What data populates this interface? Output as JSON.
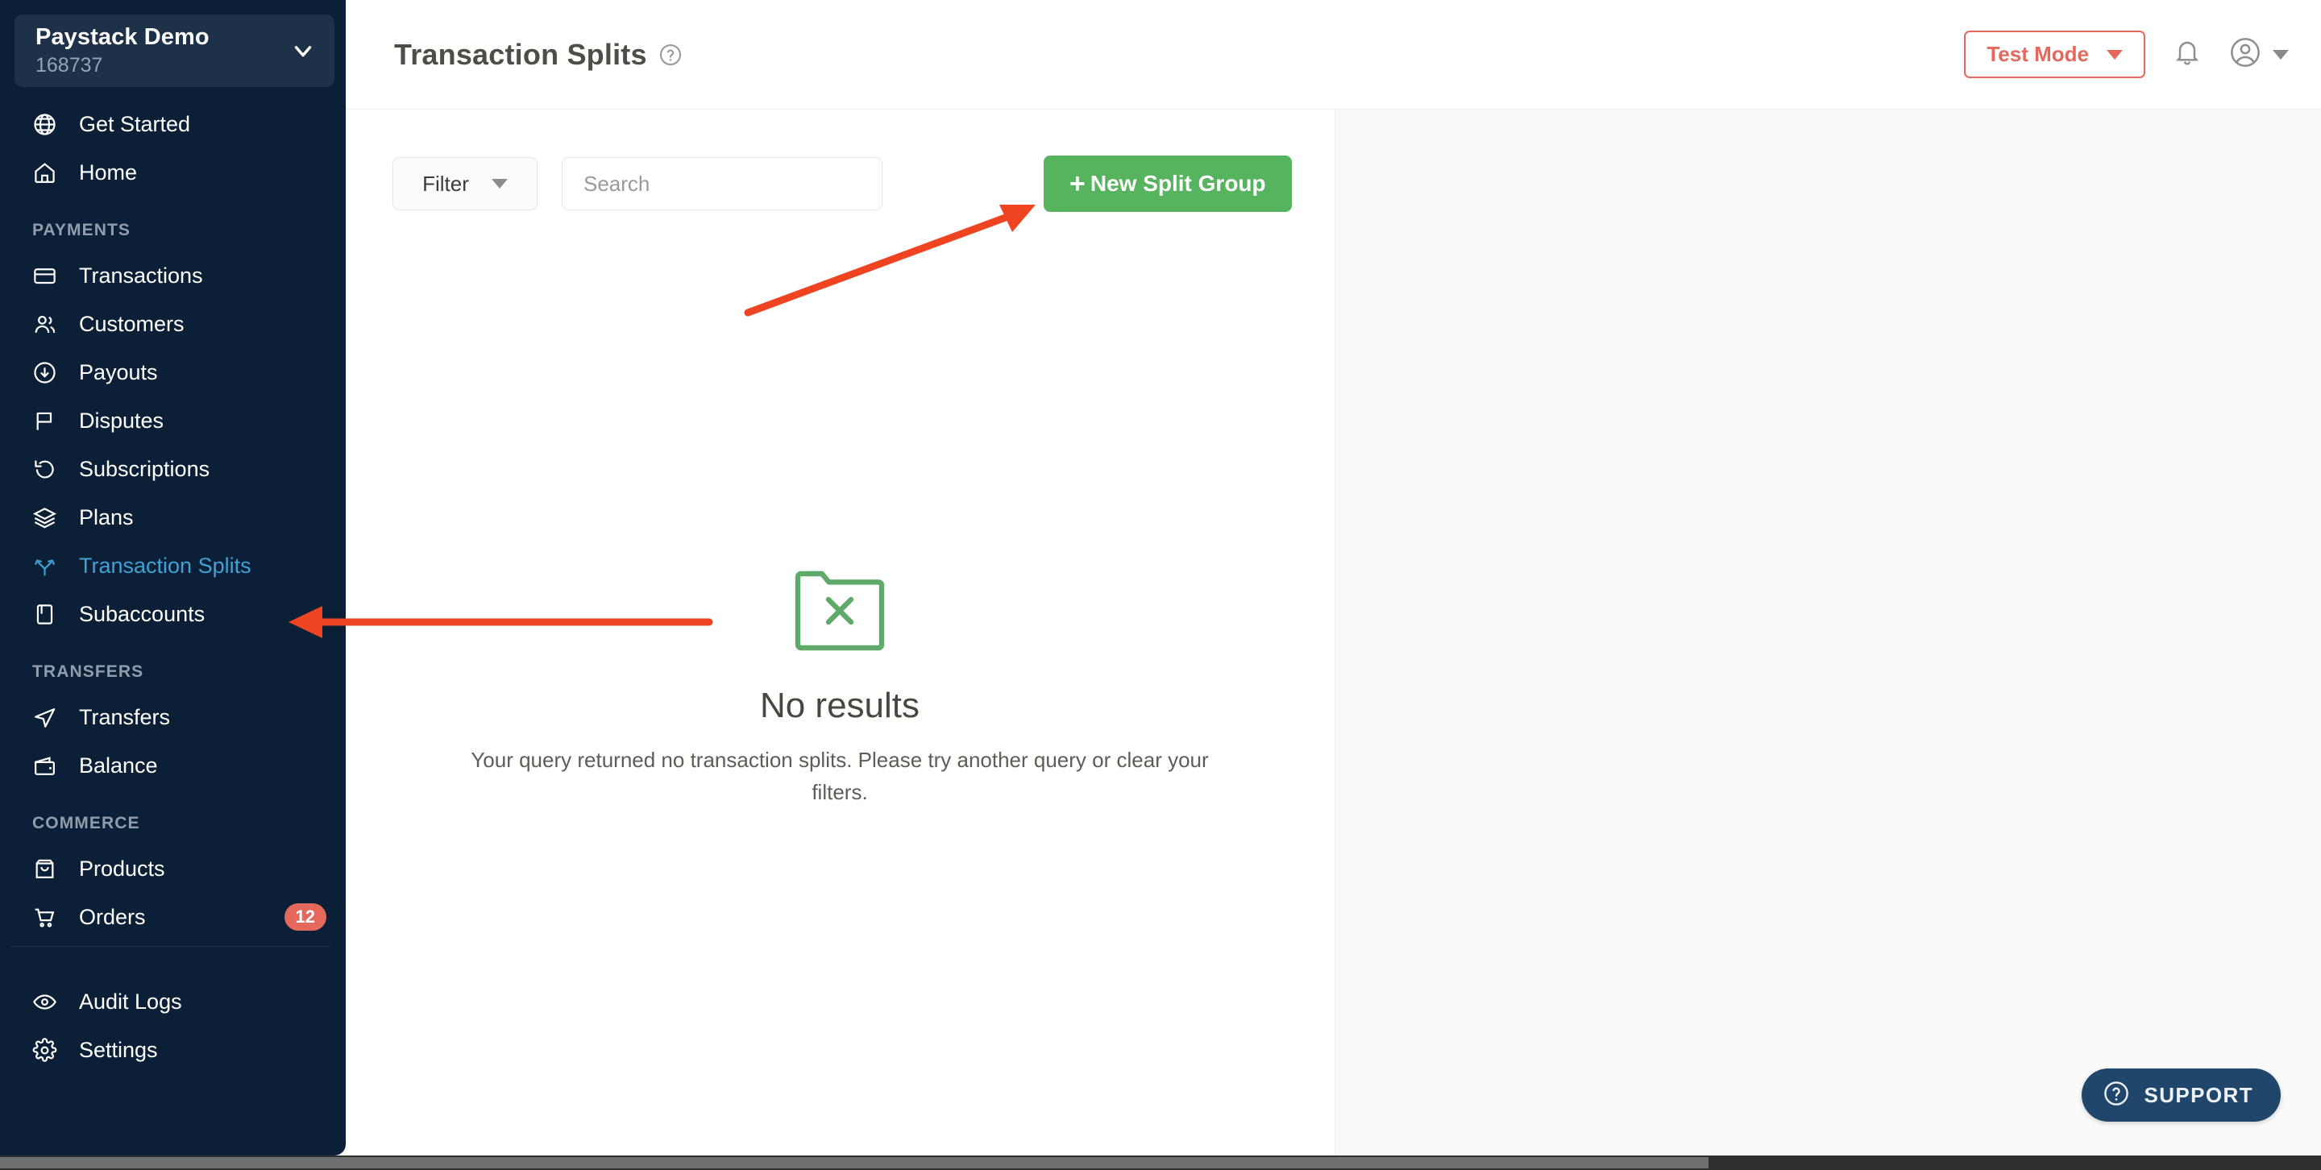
{
  "account": {
    "name": "Paystack Demo",
    "id": "168737",
    "switcher_icon": "chevron-down-icon"
  },
  "sidebar": {
    "top_items": [
      {
        "label": "Get Started",
        "icon": "globe-icon"
      },
      {
        "label": "Home",
        "icon": "home-icon"
      }
    ],
    "sections": [
      {
        "label": "PAYMENTS",
        "items": [
          {
            "label": "Transactions",
            "icon": "credit-card-icon"
          },
          {
            "label": "Customers",
            "icon": "users-icon"
          },
          {
            "label": "Payouts",
            "icon": "download-circle-icon"
          },
          {
            "label": "Disputes",
            "icon": "flag-icon"
          },
          {
            "label": "Subscriptions",
            "icon": "refresh-icon"
          },
          {
            "label": "Plans",
            "icon": "layers-icon"
          },
          {
            "label": "Transaction Splits",
            "icon": "split-fork-icon",
            "active": true
          },
          {
            "label": "Subaccounts",
            "icon": "book-icon"
          }
        ]
      },
      {
        "label": "TRANSFERS",
        "items": [
          {
            "label": "Transfers",
            "icon": "send-icon"
          },
          {
            "label": "Balance",
            "icon": "wallet-icon"
          }
        ]
      },
      {
        "label": "COMMERCE",
        "items": [
          {
            "label": "Products",
            "icon": "shopping-bag-icon"
          },
          {
            "label": "Orders",
            "icon": "shopping-cart-icon",
            "badge": "12"
          }
        ]
      }
    ],
    "footer_items": [
      {
        "label": "Audit Logs",
        "icon": "eye-icon"
      },
      {
        "label": "Settings",
        "icon": "gear-icon"
      }
    ],
    "active_color": "#3fa1d6",
    "background": "#0b2036",
    "badge_color": "#e4695c"
  },
  "header": {
    "title": "Transaction Splits",
    "help_icon": "question-circle-icon",
    "test_mode_label": "Test Mode",
    "test_mode_color": "#e4695c",
    "notifications_icon": "bell-icon",
    "avatar_icon": "user-circle-icon"
  },
  "toolbar": {
    "filter_label": "Filter",
    "search_placeholder": "Search",
    "search_value": "",
    "new_split_label": "New Split Group",
    "new_split_plus": "+",
    "new_split_color": "#57b45e"
  },
  "empty_state": {
    "icon": "folder-x-icon",
    "icon_color": "#5fa969",
    "title": "No results",
    "description": "Your query returned no transaction splits. Please try another query or clear your filters."
  },
  "support": {
    "label": "SUPPORT",
    "icon": "question-circle-icon",
    "background": "#21466b"
  },
  "annotations": {
    "color": "#ee4422",
    "arrow_to_new_split": "arrow pointing up-right to New Split Group button",
    "arrow_to_sidebar_item": "arrow pointing left to Transaction Splits sidebar item"
  }
}
